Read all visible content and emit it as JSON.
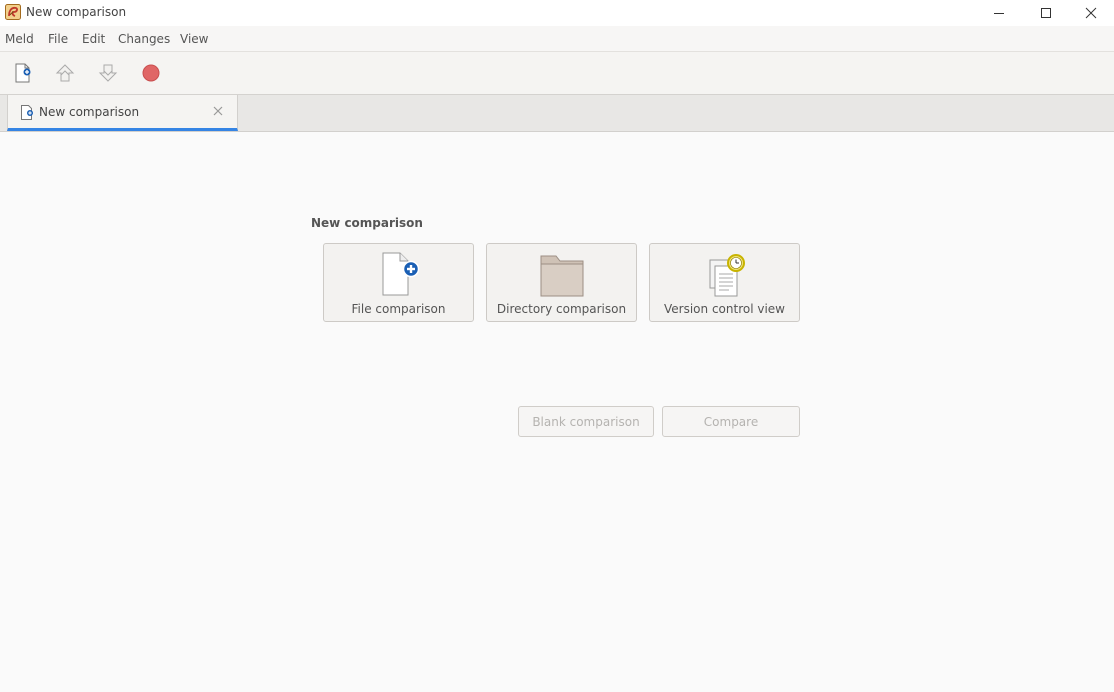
{
  "window": {
    "title": "New comparison"
  },
  "menu": [
    {
      "label": "Meld"
    },
    {
      "label": "File"
    },
    {
      "label": "Edit"
    },
    {
      "label": "Changes"
    },
    {
      "label": "View"
    }
  ],
  "toolbar": {
    "icons": [
      "new-comparison-icon",
      "previous-change-icon",
      "next-change-icon",
      "stop-icon"
    ]
  },
  "tabs": [
    {
      "label": "New comparison"
    }
  ],
  "main": {
    "section_title": "New comparison",
    "choices": [
      {
        "label": "File comparison",
        "icon": "file-add-icon"
      },
      {
        "label": "Directory comparison",
        "icon": "folder-icon"
      },
      {
        "label": "Version control view",
        "icon": "version-control-icon"
      }
    ],
    "blank_label": "Blank comparison",
    "compare_label": "Compare"
  },
  "colors": {
    "accent": "#3584e4",
    "stop": "#e06666",
    "file_plus": "#1a5fb4",
    "clock": "#c8b400"
  }
}
